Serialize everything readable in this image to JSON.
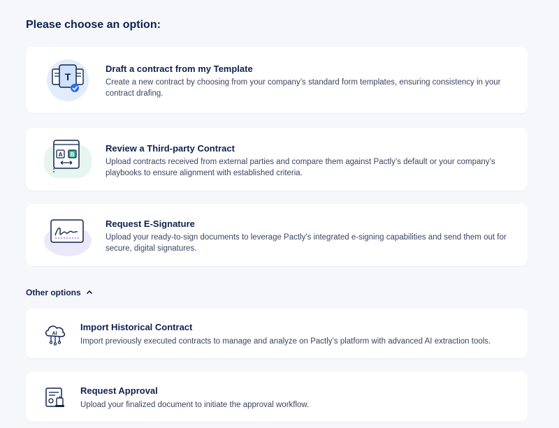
{
  "page": {
    "title": "Please choose an option:"
  },
  "options": [
    {
      "title": "Draft a contract from my Template",
      "description": "Create a new contract by choosing from your company’s standard form templates, ensuring consistency in your contract drafing.",
      "icon": "template-document-icon"
    },
    {
      "title": "Review a Third-party Contract",
      "description": "Upload contracts received from external parties and compare them against Pactly’s default or your company’s playbooks to ensure alignment with established criteria.",
      "icon": "compare-documents-icon"
    },
    {
      "title": "Request E-Signature",
      "description": "Upload your ready-to-sign documents to leverage Pactly's integrated e-signing capabilities and send them out for secure, digital signatures.",
      "icon": "signature-icon"
    }
  ],
  "other_options": {
    "label": "Other options",
    "expanded": true,
    "items": [
      {
        "title": "Import Historical Contract",
        "description": "Import previously executed contracts to manage and analyze on Pactly’s platform with advanced AI extraction tools.",
        "icon": "ai-cloud-icon",
        "icon_text": "AI"
      },
      {
        "title": "Request Approval",
        "description": "Upload your finalized document to initiate the approval workflow.",
        "icon": "approval-document-icon"
      }
    ]
  },
  "colors": {
    "background": "#f6f7fb",
    "card": "#ffffff",
    "heading": "#0e2250",
    "text": "#3b4560",
    "accent_blue": "#2f6fe4",
    "accent_green": "#3dbb8a",
    "icon_tint_blue": "#e3ecfb",
    "icon_tint_green": "#e6f5ee",
    "icon_tint_purple": "#ebe8fa"
  }
}
